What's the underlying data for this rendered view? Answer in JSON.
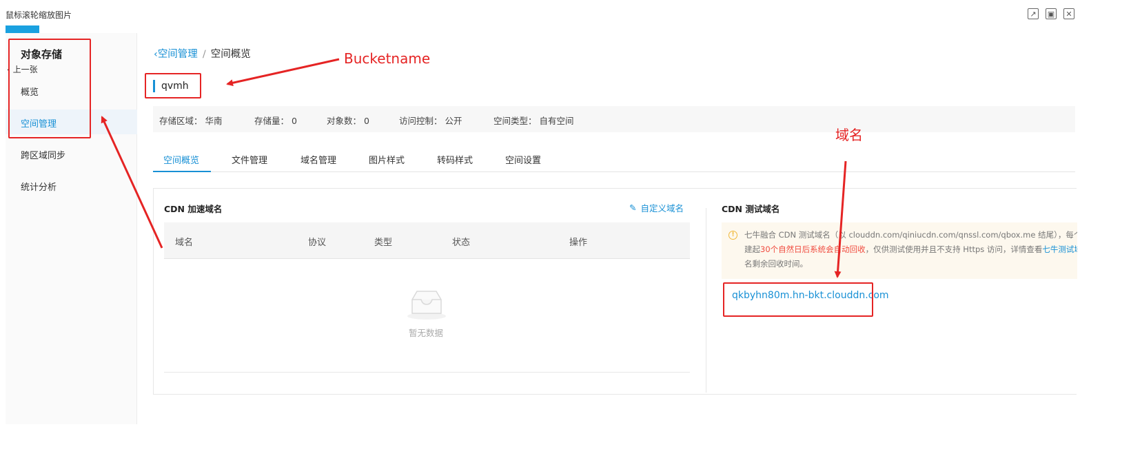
{
  "viewer": {
    "title": "鼠标滚轮缩放图片",
    "prev_label": "上一张",
    "accent_color": "#1aa1e0"
  },
  "sidebar": {
    "title": "对象存储",
    "items": [
      {
        "label": "概览",
        "active": false
      },
      {
        "label": "空间管理",
        "active": true
      },
      {
        "label": "跨区域同步",
        "active": false
      },
      {
        "label": "统计分析",
        "active": false
      }
    ]
  },
  "breadcrumb": {
    "parent": "空间管理",
    "separator": "/",
    "current": "空间概览"
  },
  "bucket": {
    "name": "qvmh"
  },
  "info": {
    "region_label": "存储区域：",
    "region_value": "华南",
    "storage_label": "存储量：",
    "storage_value": "0",
    "objects_label": "对象数：",
    "objects_value": "0",
    "access_label": "访问控制：",
    "access_value": "公开",
    "type_label": "空间类型：",
    "type_value": "自有空间"
  },
  "tabs": [
    "空间概览",
    "文件管理",
    "域名管理",
    "图片样式",
    "转码样式",
    "空间设置"
  ],
  "cdn": {
    "heading": "CDN 加速域名",
    "custom_domain_label": "自定义域名",
    "columns": [
      "域名",
      "协议",
      "类型",
      "状态",
      "操作"
    ],
    "empty_text": "暂无数据"
  },
  "test_cdn": {
    "heading": "CDN 测试域名",
    "notice_line1": "七牛融合 CDN 测试域名（以 clouddn.com/qiniucdn.com/qnssl.com/qbox.me 结尾），每个域名",
    "notice_line2_prefix": "建起",
    "notice_line2_red": "30个自然日后系统会自动回收",
    "notice_line2_mid": "，仅供测试使用并且不支持 Https 访问，详情查看",
    "notice_line2_link": "七牛测试域",
    "notice_line3": "名剩余回收时间。",
    "domain": "qkbyhn80m.hn-bkt.clouddn.com"
  },
  "annotations": {
    "bucketname_label": "Bucketname",
    "domain_label": "域名",
    "color": "#e52424"
  },
  "colors": {
    "primary": "#1890d5",
    "notice_bg": "#fdf8ee"
  }
}
